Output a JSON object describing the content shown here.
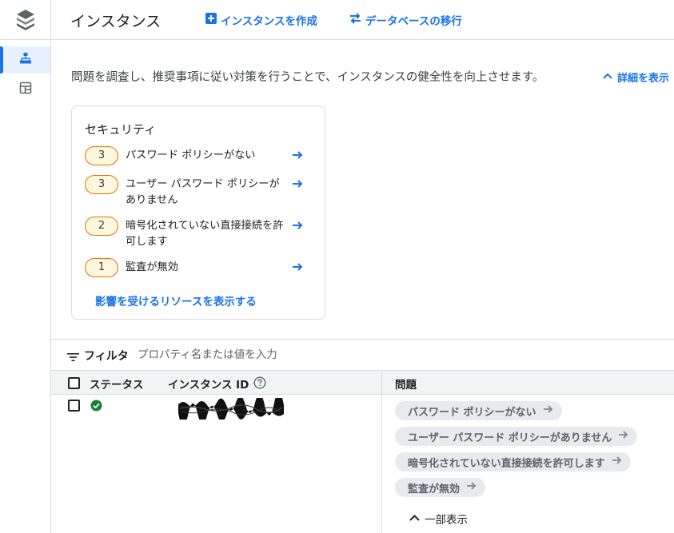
{
  "header": {
    "title": "インスタンス",
    "create_label": "インスタンスを作成",
    "migrate_label": "データベースの移行"
  },
  "description": {
    "text": "問題を調査し、推奨事項に従い対策を行うことで、インスタンスの健全性を向上させます。",
    "details_link": "詳細を表示"
  },
  "security_card": {
    "title": "セキュリティ",
    "items": [
      {
        "count": "3",
        "label": "パスワード ポリシーがない"
      },
      {
        "count": "3",
        "label": "ユーザー パスワード ポリシーがありません"
      },
      {
        "count": "2",
        "label": "暗号化されていない直接接続を許可します"
      },
      {
        "count": "1",
        "label": "監査が無効"
      }
    ],
    "link": "影響を受けるリソースを表示する"
  },
  "filter": {
    "label": "フィルタ",
    "placeholder": "プロパティ名または値を入力"
  },
  "table": {
    "columns": {
      "status": "ステータス",
      "instance_id": "インスタンス ID",
      "issues": "問題"
    },
    "rows": [
      {
        "status": "ok",
        "issues": [
          "パスワード ポリシーがない",
          "ユーザー パスワード ポリシーがありません",
          "暗号化されていない直接接続を許可します",
          "監査が無効"
        ],
        "show_less": "一部表示"
      }
    ]
  },
  "colors": {
    "accent": "#1a73e8",
    "warning_border": "#e37400",
    "warning_fill": "#fef7e0",
    "success": "#188038",
    "chip_bg": "#e8eaed"
  },
  "icons": {
    "logo": "database-stack-icon",
    "rail": [
      "hierarchy-icon",
      "dashboard-layout-icon"
    ],
    "create": "add-box-icon",
    "migrate": "swap-arrows-icon",
    "details": "chevron-up-icon",
    "row_arrow": "arrow-right-icon",
    "filter": "filter-lines-icon",
    "help": "help-circle-icon",
    "status_ok": "check-circle-icon"
  }
}
